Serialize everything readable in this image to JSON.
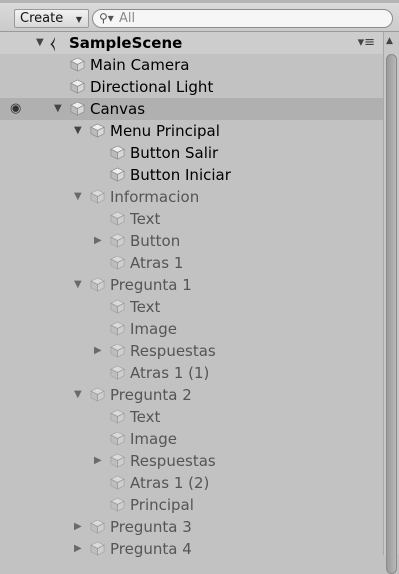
{
  "toolbar": {
    "create_label": "Create",
    "search_placeholder": "All",
    "search_icon": "search-icon",
    "caret_icon": "dropdown-caret-icon"
  },
  "colors": {
    "scene_row": "#cdcdcd",
    "selected_row": "#b0b0b0",
    "background": "#c2c2c2",
    "active_text": "#000000",
    "inactive_text": "#555555"
  },
  "scene": {
    "name": "SampleScene",
    "expanded": true
  },
  "hierarchy": [
    {
      "label": "Main Camera",
      "depth": 1,
      "foldout": "none",
      "active": true
    },
    {
      "label": "Directional Light",
      "depth": 1,
      "foldout": "none",
      "active": true
    },
    {
      "label": "Canvas",
      "depth": 1,
      "foldout": "open",
      "active": true,
      "selected": true,
      "visibility_icon": "eye-icon"
    },
    {
      "label": "Menu Principal",
      "depth": 2,
      "foldout": "open",
      "active": true
    },
    {
      "label": "Button Salir",
      "depth": 3,
      "foldout": "none",
      "active": true
    },
    {
      "label": "Button Iniciar",
      "depth": 3,
      "foldout": "none",
      "active": true
    },
    {
      "label": "Informacion",
      "depth": 2,
      "foldout": "open",
      "active": false
    },
    {
      "label": "Text",
      "depth": 3,
      "foldout": "none",
      "active": false
    },
    {
      "label": "Button",
      "depth": 3,
      "foldout": "closed",
      "active": false
    },
    {
      "label": "Atras 1",
      "depth": 3,
      "foldout": "none",
      "active": false
    },
    {
      "label": "Pregunta 1",
      "depth": 2,
      "foldout": "open",
      "active": false
    },
    {
      "label": "Text",
      "depth": 3,
      "foldout": "none",
      "active": false
    },
    {
      "label": "Image",
      "depth": 3,
      "foldout": "none",
      "active": false
    },
    {
      "label": "Respuestas",
      "depth": 3,
      "foldout": "closed",
      "active": false
    },
    {
      "label": "Atras 1 (1)",
      "depth": 3,
      "foldout": "none",
      "active": false
    },
    {
      "label": "Pregunta 2",
      "depth": 2,
      "foldout": "open",
      "active": false
    },
    {
      "label": "Text",
      "depth": 3,
      "foldout": "none",
      "active": false
    },
    {
      "label": "Image",
      "depth": 3,
      "foldout": "none",
      "active": false
    },
    {
      "label": "Respuestas",
      "depth": 3,
      "foldout": "closed",
      "active": false
    },
    {
      "label": "Atras 1 (2)",
      "depth": 3,
      "foldout": "none",
      "active": false
    },
    {
      "label": "Principal",
      "depth": 3,
      "foldout": "none",
      "active": false
    },
    {
      "label": "Pregunta 3",
      "depth": 2,
      "foldout": "closed",
      "active": false
    },
    {
      "label": "Pregunta 4",
      "depth": 2,
      "foldout": "closed",
      "active": false
    }
  ]
}
